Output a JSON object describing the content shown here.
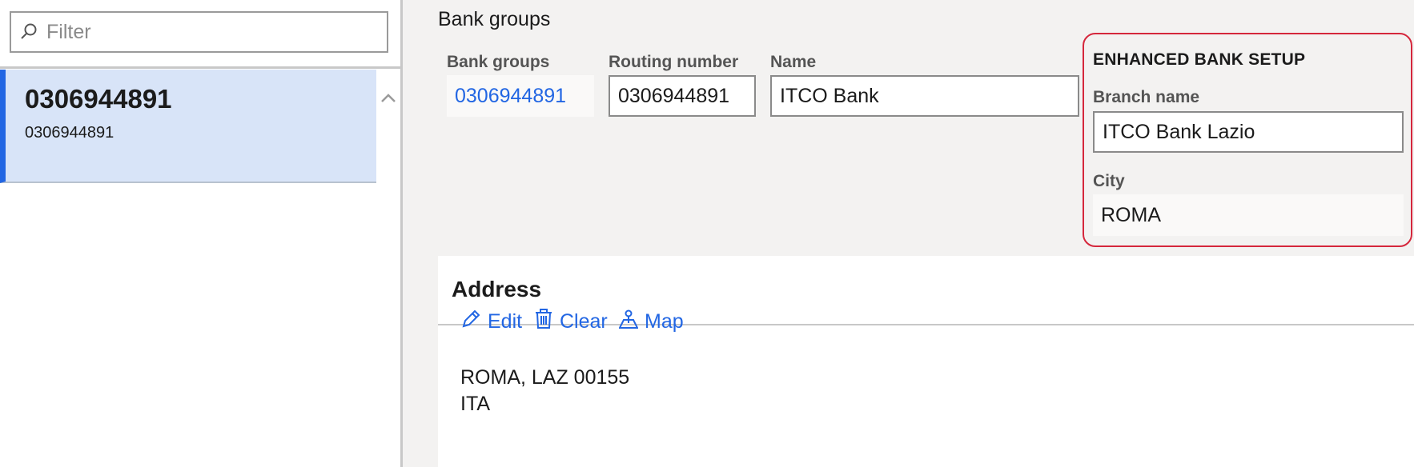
{
  "filter": {
    "placeholder": "Filter"
  },
  "list": {
    "items": [
      {
        "title": "0306944891",
        "subtitle": "0306944891"
      }
    ]
  },
  "detail": {
    "section_title": "Bank groups",
    "fields": {
      "bank_groups": {
        "label": "Bank groups",
        "value": "0306944891"
      },
      "routing_number": {
        "label": "Routing number",
        "value": "0306944891"
      },
      "name": {
        "label": "Name",
        "value": "ITCO Bank"
      }
    },
    "enhanced": {
      "title": "ENHANCED BANK SETUP",
      "branch_name": {
        "label": "Branch name",
        "value": "ITCO Bank Lazio"
      },
      "city": {
        "label": "City",
        "value": "ROMA"
      }
    },
    "address": {
      "title": "Address",
      "actions": {
        "edit": "Edit",
        "clear": "Clear",
        "map": "Map"
      },
      "lines": [
        "ROMA, LAZ 00155",
        "ITA"
      ]
    }
  },
  "colors": {
    "accent": "#2266e3",
    "highlight_border": "#d5273c",
    "selected_row": "#d8e4f8"
  },
  "icons": {
    "filter": "search-icon",
    "scroll": "chevron-up-icon",
    "edit": "pencil-icon",
    "clear": "trash-icon",
    "map": "map-icon"
  }
}
